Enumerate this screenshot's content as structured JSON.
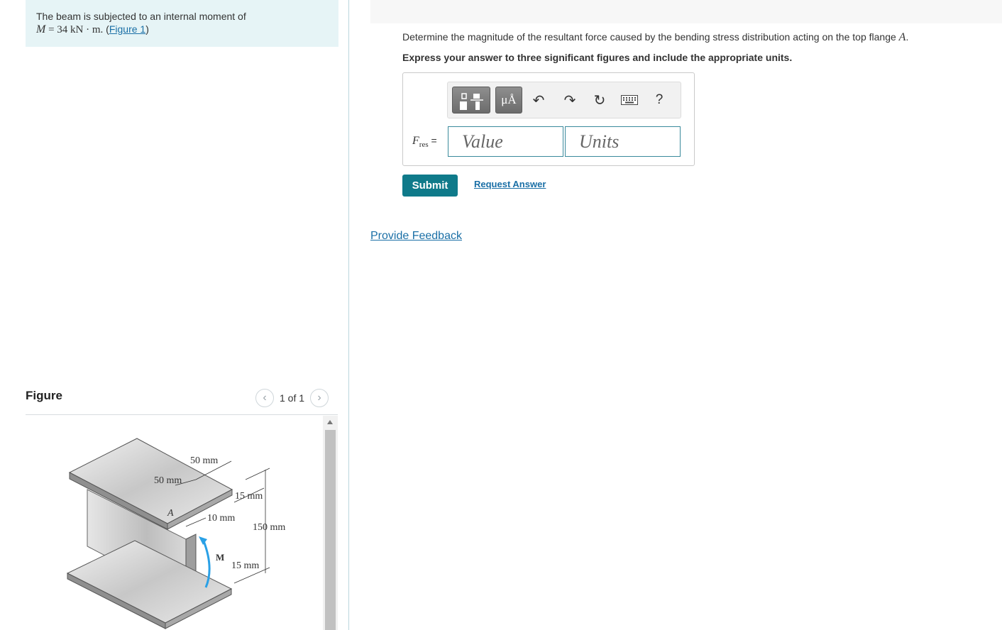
{
  "problem": {
    "line1": "The beam is subjected to an internal moment of",
    "m_symbol": "M",
    "m_value": " = 34 kN · m.",
    "figure_link_open": " (",
    "figure_link": "Figure 1",
    "figure_link_close": ")"
  },
  "figure": {
    "title": "Figure",
    "pager": "1 of 1",
    "labels": {
      "top_width": "50 mm",
      "top_left": "50 mm",
      "flange_top": "15 mm",
      "web": "10 mm",
      "height": "150 mm",
      "flange_bottom": "15 mm",
      "point": "A",
      "moment": "M"
    }
  },
  "question": {
    "text": "Determine the magnitude of the resultant force caused by the bending stress distribution acting on the top flange ",
    "flange_symbol": "A",
    "period": ".",
    "instruction": "Express your answer to three significant figures and include the appropriate units."
  },
  "answer": {
    "label_main": "F",
    "label_sub": "res",
    "label_eq": " =",
    "value_placeholder": "Value",
    "units_placeholder": "Units"
  },
  "toolbar": {
    "templates_icon": "templates-icon",
    "units_symbol": "μÅ",
    "help": "?"
  },
  "buttons": {
    "submit": "Submit",
    "request_answer": "Request Answer",
    "provide_feedback": "Provide Feedback"
  }
}
